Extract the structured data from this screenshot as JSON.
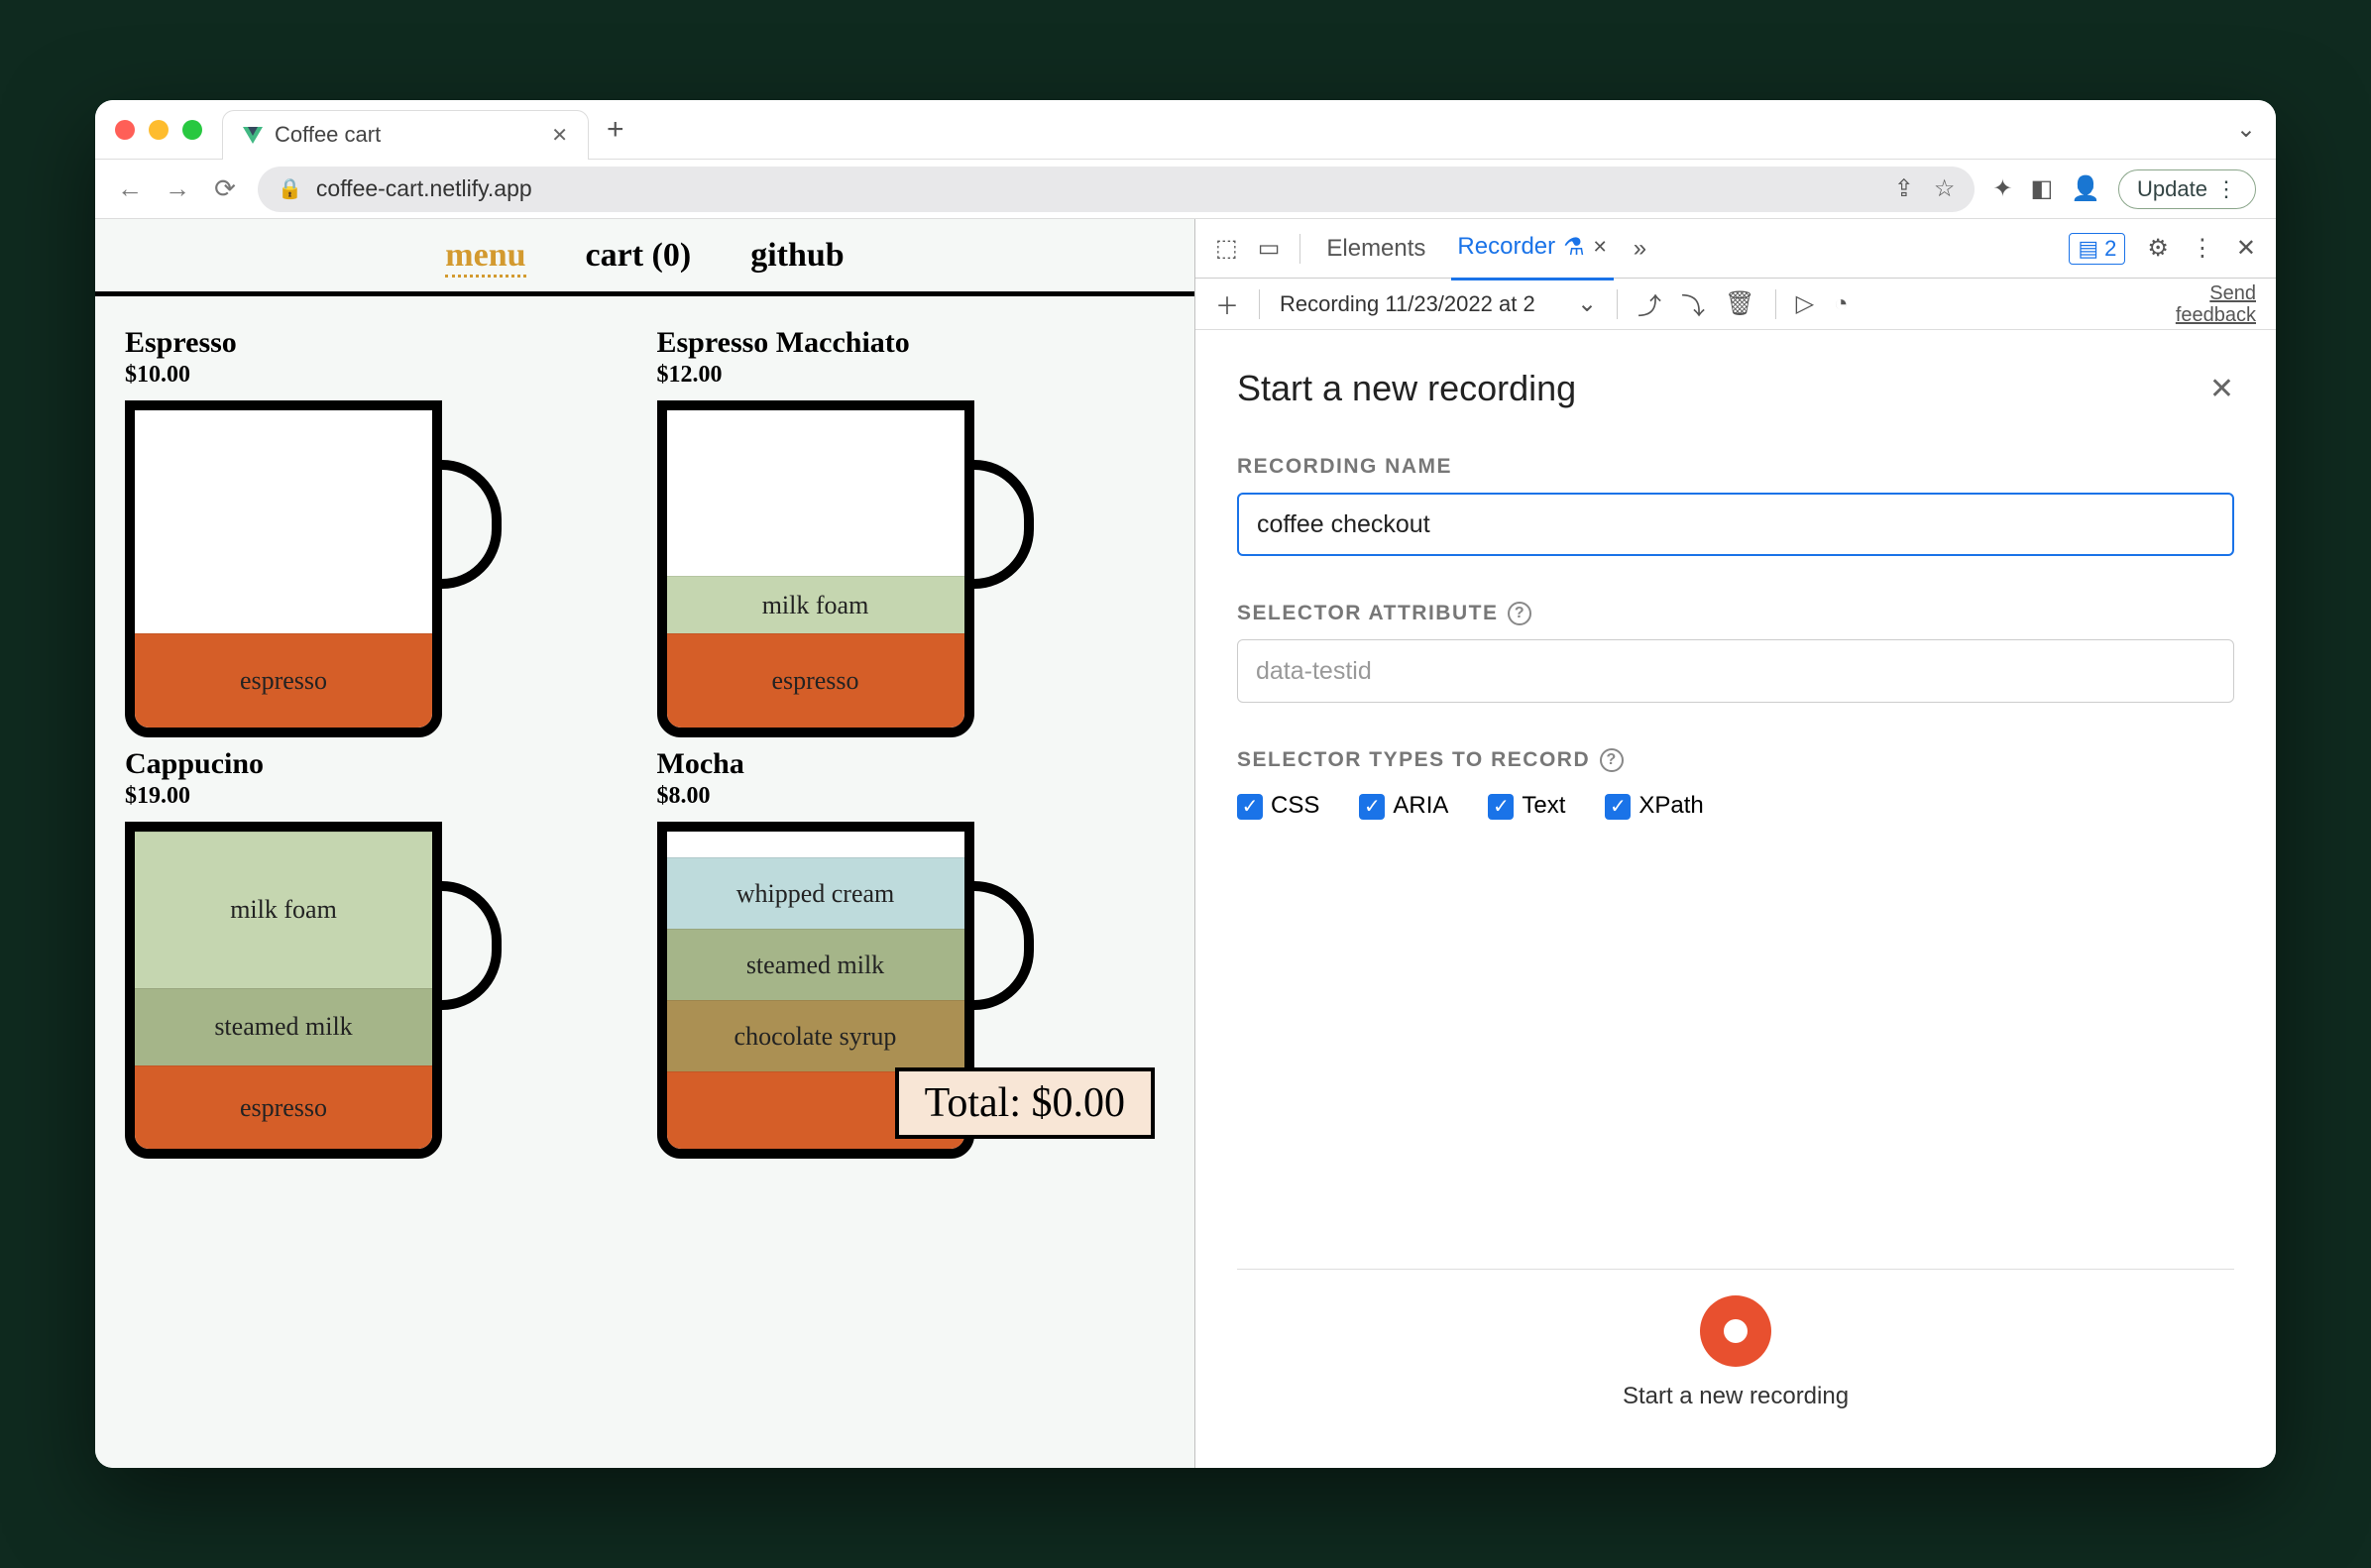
{
  "browser": {
    "tab_title": "Coffee cart",
    "url_text": "coffee-cart.netlify.app",
    "update_label": "Update"
  },
  "page": {
    "nav": {
      "menu": "menu",
      "cart": "cart (0)",
      "github": "github"
    },
    "items": [
      {
        "name": "Espresso",
        "price": "$10.00"
      },
      {
        "name": "Espresso Macchiato",
        "price": "$12.00"
      },
      {
        "name": "Cappucino",
        "price": "$19.00"
      },
      {
        "name": "Mocha",
        "price": "$8.00"
      }
    ],
    "layers": {
      "espresso": "espresso",
      "milk_foam": "milk foam",
      "steamed_milk": "steamed milk",
      "whipped_cream": "whipped cream",
      "chocolate_syrup": "chocolate syrup"
    },
    "total_label": "Total: $0.00"
  },
  "devtools": {
    "tabs": {
      "elements": "Elements",
      "recorder": "Recorder"
    },
    "messages_count": "2",
    "toolbar_recording": "Recording 11/23/2022 at 2",
    "feedback_l1": "Send",
    "feedback_l2": "feedback",
    "panel_title": "Start a new recording",
    "recording_name_label": "RECORDING NAME",
    "recording_name_value": "coffee checkout",
    "selector_attr_label": "SELECTOR ATTRIBUTE",
    "selector_attr_placeholder": "data-testid",
    "selector_types_label": "SELECTOR TYPES TO RECORD",
    "checks": {
      "css": "CSS",
      "aria": "ARIA",
      "text": "Text",
      "xpath": "XPath"
    },
    "start_caption": "Start a new recording"
  }
}
